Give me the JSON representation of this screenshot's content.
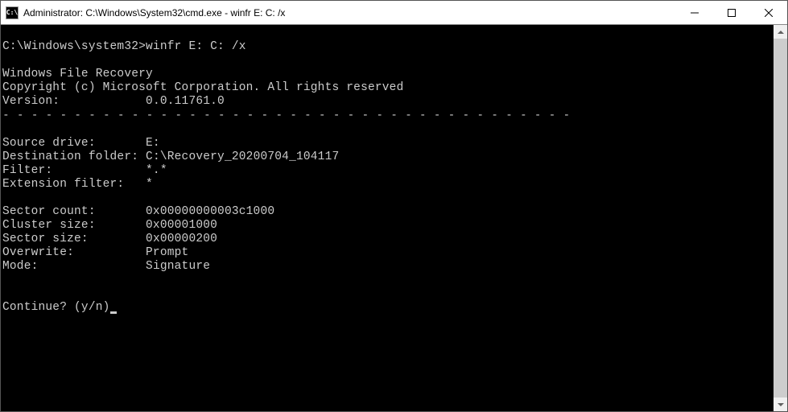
{
  "window": {
    "title": "Administrator: C:\\Windows\\System32\\cmd.exe - winfr  E: C: /x",
    "icon_label": "C:\\"
  },
  "prompt": {
    "path": "C:\\Windows\\system32>",
    "command": "winfr E: C: /x"
  },
  "output": {
    "app_name": "Windows File Recovery",
    "copyright": "Copyright (c) Microsoft Corporation. All rights reserved",
    "version_label": "Version:",
    "version_value": "0.0.11761.0",
    "divider": "- - - - - - - - - - - - - - - - - - - - - - - - - - - - - - - - - - - - - - - -",
    "source_drive_label": "Source drive:",
    "source_drive_value": "E:",
    "dest_folder_label": "Destination folder:",
    "dest_folder_value": "C:\\Recovery_20200704_104117",
    "filter_label": "Filter:",
    "filter_value": "*.*",
    "ext_filter_label": "Extension filter:",
    "ext_filter_value": "*",
    "sector_count_label": "Sector count:",
    "sector_count_value": "0x00000000003c1000",
    "cluster_size_label": "Cluster size:",
    "cluster_size_value": "0x00001000",
    "sector_size_label": "Sector size:",
    "sector_size_value": "0x00000200",
    "overwrite_label": "Overwrite:",
    "overwrite_value": "Prompt",
    "mode_label": "Mode:",
    "mode_value": "Signature",
    "continue_prompt": "Continue? (y/n)"
  }
}
